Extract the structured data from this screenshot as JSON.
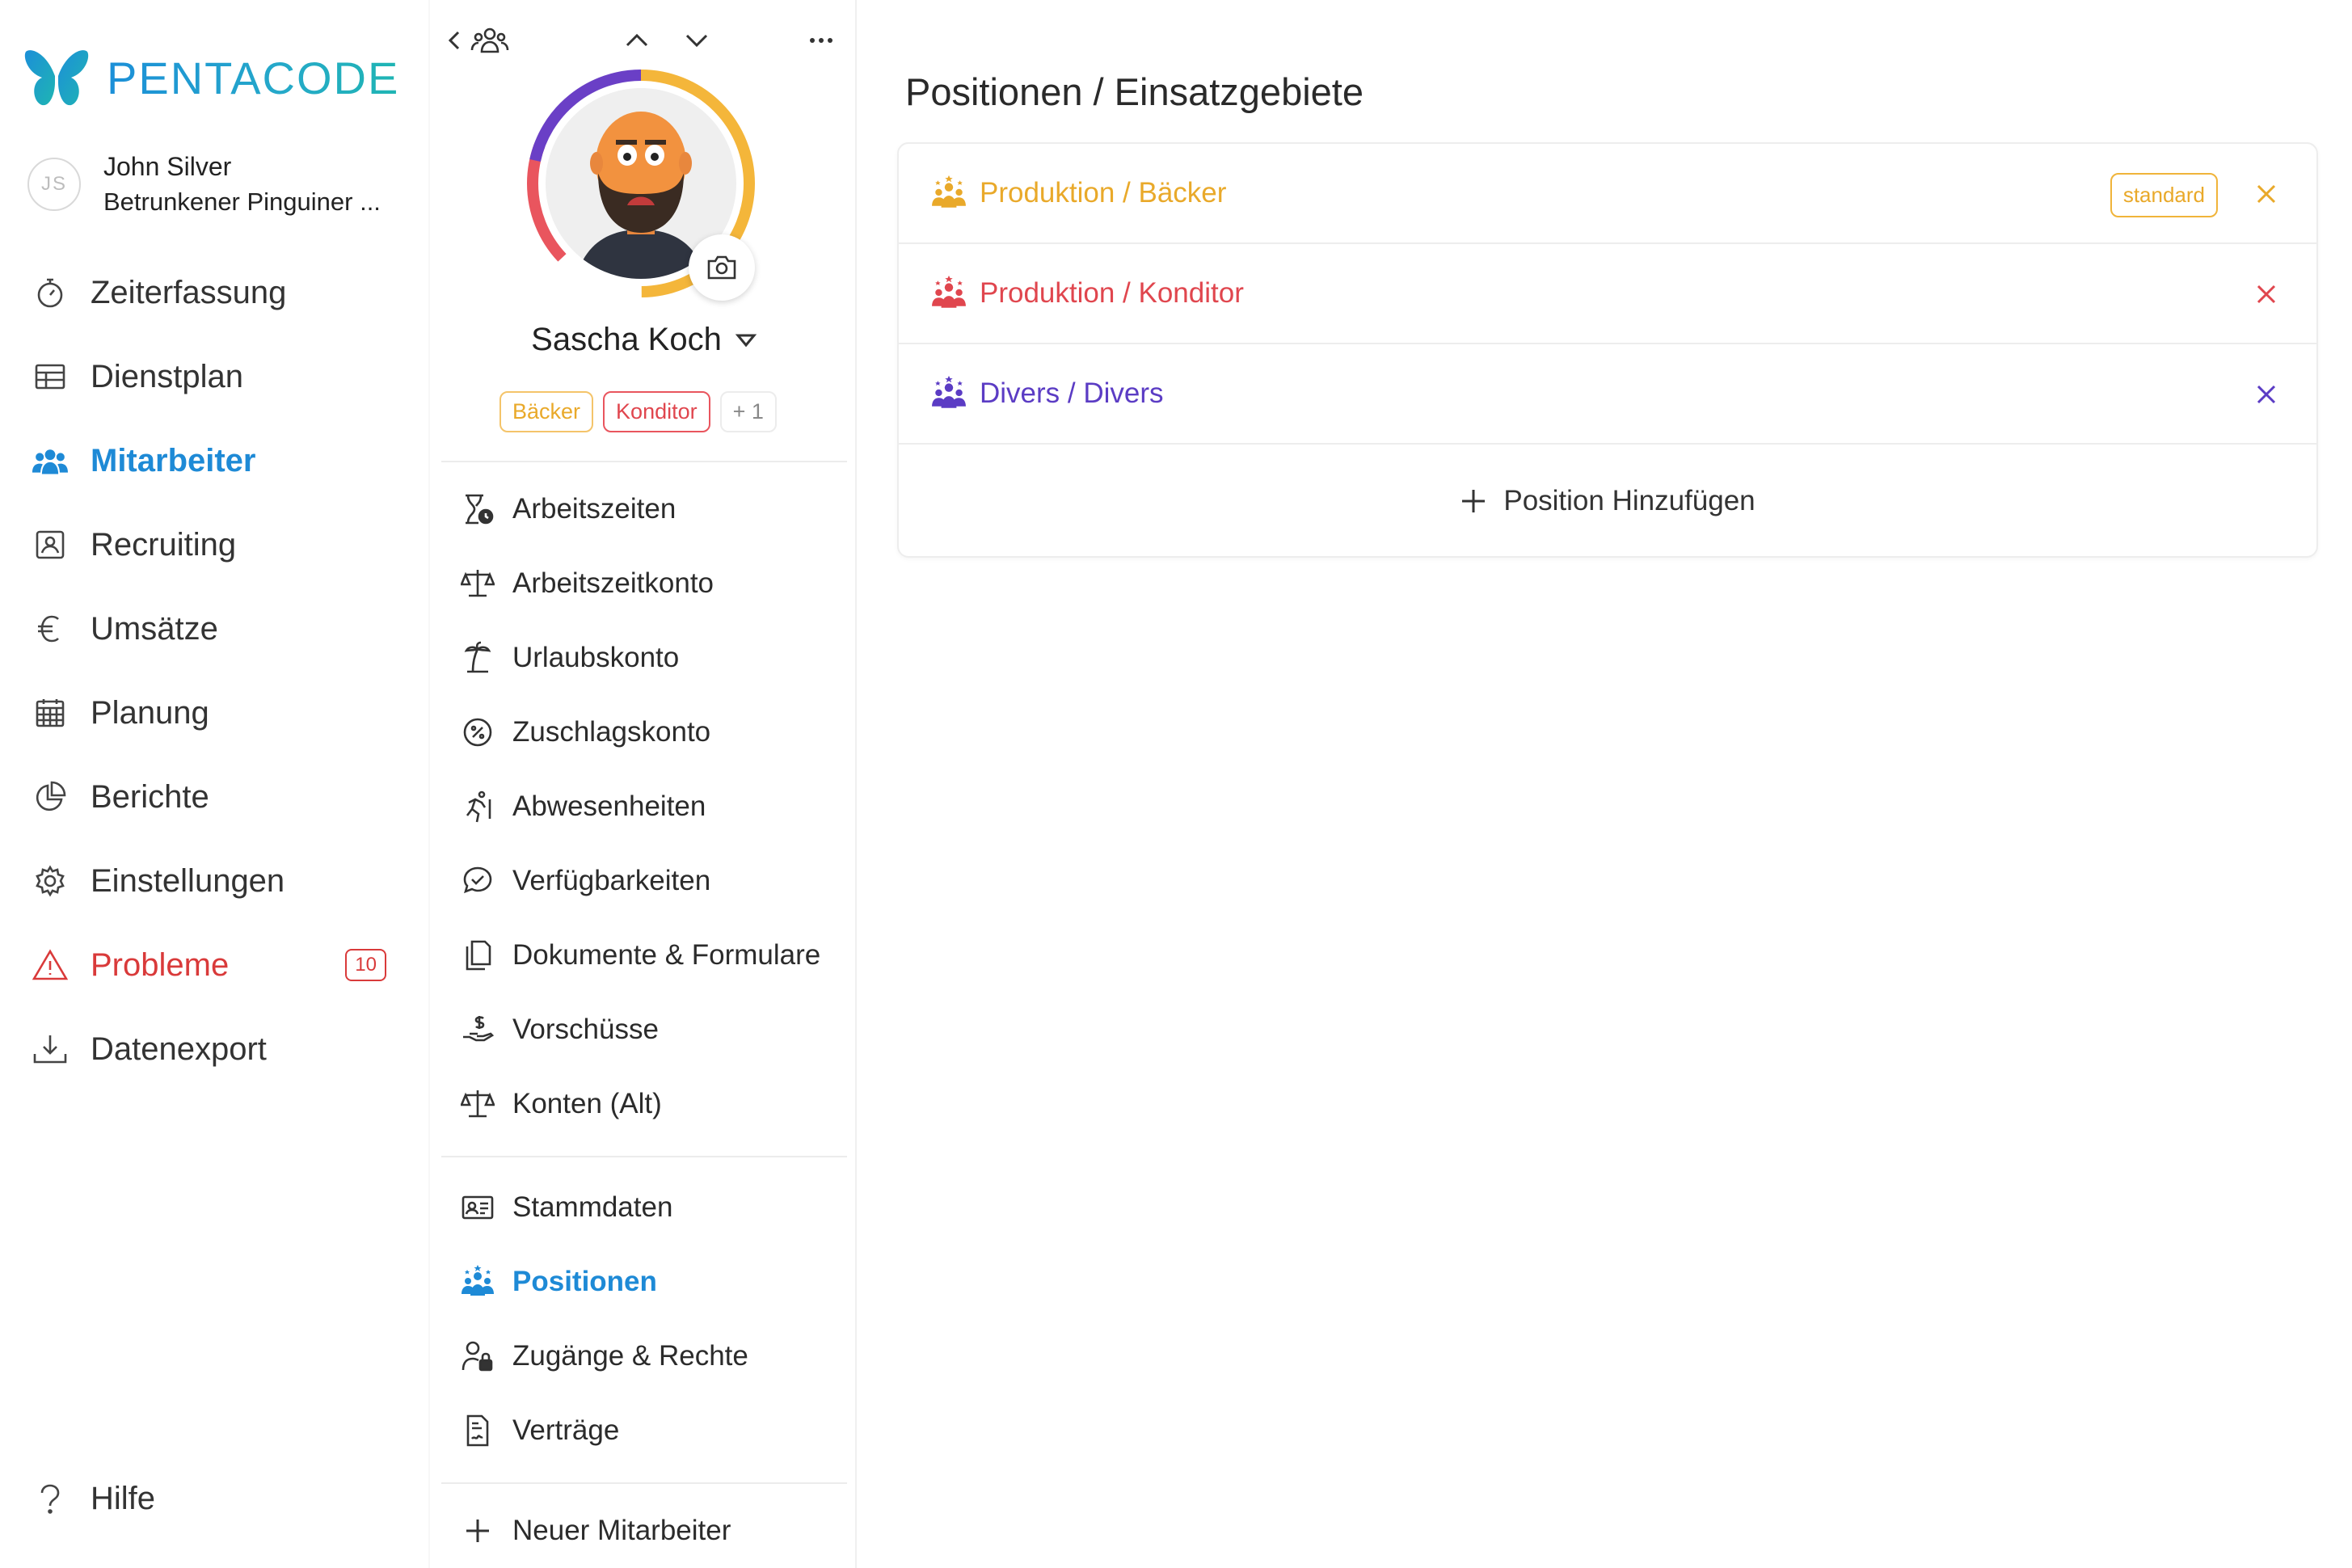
{
  "brand": {
    "name": "PENTACODE",
    "colors": {
      "primary": "#1e8ad6",
      "teal": "#1fb5b3"
    }
  },
  "user": {
    "initials": "JS",
    "name": "John Silver",
    "org": "Betrunkener Pinguiner ..."
  },
  "sidebar": {
    "items": [
      {
        "label": "Zeiterfassung",
        "icon": "stopwatch-icon"
      },
      {
        "label": "Dienstplan",
        "icon": "table-icon"
      },
      {
        "label": "Mitarbeiter",
        "icon": "people-icon",
        "active": true
      },
      {
        "label": "Recruiting",
        "icon": "id-badge-icon"
      },
      {
        "label": "Umsätze",
        "icon": "euro-icon"
      },
      {
        "label": "Planung",
        "icon": "calendar-grid-icon"
      },
      {
        "label": "Berichte",
        "icon": "pie-chart-icon"
      },
      {
        "label": "Einstellungen",
        "icon": "gear-icon"
      },
      {
        "label": "Probleme",
        "icon": "warning-icon",
        "badge": "10"
      },
      {
        "label": "Datenexport",
        "icon": "download-icon"
      }
    ],
    "help": "Hilfe"
  },
  "employee": {
    "name": "Sascha Koch",
    "tags": [
      {
        "label": "Bäcker",
        "color": "#e9a92a"
      },
      {
        "label": "Konditor",
        "color": "#e0464e"
      },
      {
        "label": "+ 1",
        "color": "#888888"
      }
    ]
  },
  "menu": {
    "group1": [
      {
        "label": "Arbeitszeiten",
        "icon": "hourglass-clock-icon"
      },
      {
        "label": "Arbeitszeitkonto",
        "icon": "scale-icon"
      },
      {
        "label": "Urlaubskonto",
        "icon": "palm-tree-icon"
      },
      {
        "label": "Zuschlagskonto",
        "icon": "percent-badge-icon"
      },
      {
        "label": "Abwesenheiten",
        "icon": "running-person-icon"
      },
      {
        "label": "Verfügbarkeiten",
        "icon": "chat-check-icon"
      },
      {
        "label": "Dokumente & Formulare",
        "icon": "documents-icon"
      },
      {
        "label": "Vorschüsse",
        "icon": "hand-money-icon"
      },
      {
        "label": "Konten (Alt)",
        "icon": "scale-icon"
      }
    ],
    "group2": [
      {
        "label": "Stammdaten",
        "icon": "id-card-icon"
      },
      {
        "label": "Positionen",
        "icon": "positions-icon",
        "active": true
      },
      {
        "label": "Zugänge & Rechte",
        "icon": "user-lock-icon"
      },
      {
        "label": "Verträge",
        "icon": "contract-icon"
      }
    ],
    "new_employee": "Neuer Mitarbeiter"
  },
  "main": {
    "title": "Positionen / Einsatzgebiete",
    "positions": [
      {
        "label": "Produktion / Bäcker",
        "color": "#e9a92a",
        "badge": "standard"
      },
      {
        "label": "Produktion / Konditor",
        "color": "#e0464e"
      },
      {
        "label": "Divers / Divers",
        "color": "#5b3cc4"
      }
    ],
    "add_label": "Position Hinzufügen"
  }
}
